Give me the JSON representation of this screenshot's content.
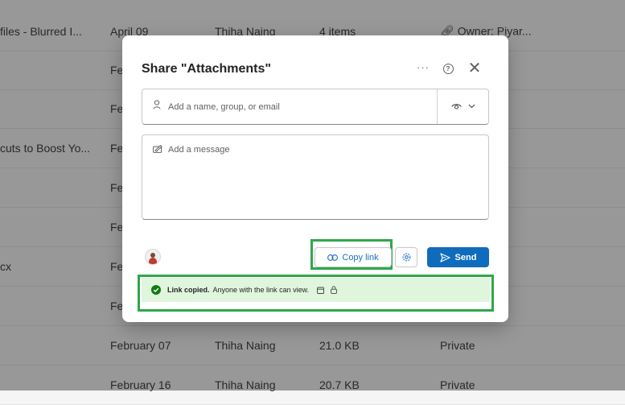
{
  "background_rows": [
    {
      "name": "files - Blurred I...",
      "date": "April 09",
      "modified_by": "Thiha Naing",
      "size": "4 items",
      "sharing": "Owner: Piyar..."
    },
    {
      "name": "",
      "date": "Fe",
      "modified_by": "",
      "size": "",
      "sharing": ""
    },
    {
      "name": "",
      "date": "Fe",
      "modified_by": "",
      "size": "",
      "sharing": ""
    },
    {
      "name": "cuts to Boost Yo...",
      "date": "Fe",
      "modified_by": "",
      "size": "",
      "sharing": ""
    },
    {
      "name": "",
      "date": "Fe",
      "modified_by": "",
      "size": "",
      "sharing": ""
    },
    {
      "name": "",
      "date": "Fe",
      "modified_by": "",
      "size": "",
      "sharing": ""
    },
    {
      "name": "cx",
      "date": "Fe",
      "modified_by": "",
      "size": "",
      "sharing": ""
    },
    {
      "name": "",
      "date": "Fe",
      "modified_by": "",
      "size": "",
      "sharing": ""
    },
    {
      "name": "",
      "date": "February 07",
      "modified_by": "Thiha Naing",
      "size": "21.0 KB",
      "sharing": "Private"
    },
    {
      "name": "",
      "date": "February 16",
      "modified_by": "Thiha Naing",
      "size": "20.7 KB",
      "sharing": "Private"
    }
  ],
  "dialog": {
    "title": "Share \"Attachments\"",
    "more_label": "···",
    "close_label": "✕",
    "recipients_placeholder": "Add a name, group, or email",
    "message_placeholder": "Add a message",
    "copy_link_label": "Copy link",
    "send_label": "Send",
    "banner": {
      "bold": "Link copied.",
      "text": "Anyone with the link can view."
    }
  },
  "colors": {
    "accent": "#0f6cbd",
    "link_text": "#1e6fc4",
    "success_bg": "#dff6dd",
    "success_icon": "#107c10",
    "highlight": "#2ea84a"
  }
}
